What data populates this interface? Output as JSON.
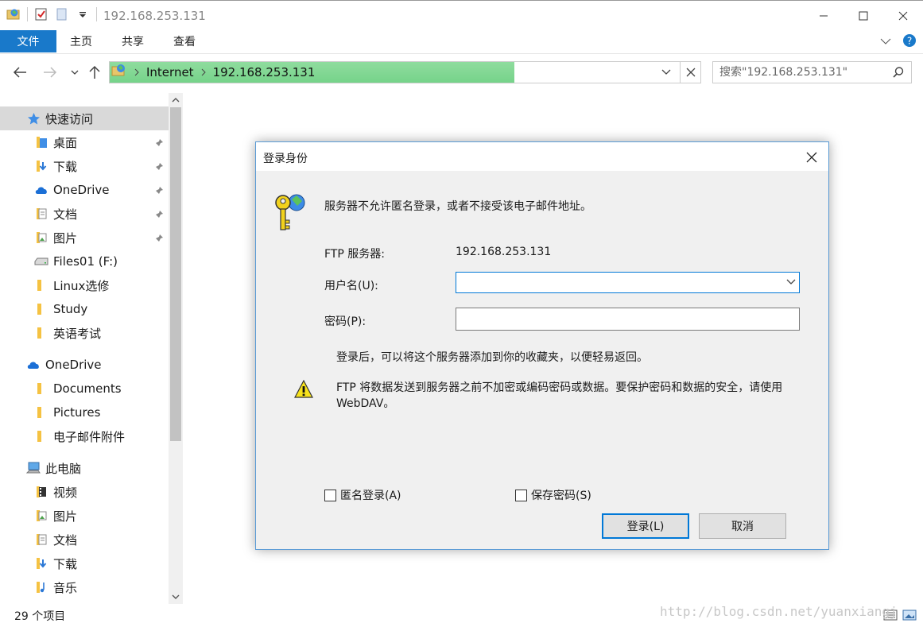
{
  "window": {
    "title": "192.168.253.131"
  },
  "ribbon": {
    "file": "文件",
    "tabs": [
      "主页",
      "共享",
      "查看"
    ]
  },
  "address": {
    "segments": [
      "Internet",
      "192.168.253.131"
    ]
  },
  "search": {
    "placeholder": "搜索\"192.168.253.131\""
  },
  "sidebar": {
    "items": [
      {
        "label": "快速访问",
        "icon": "star-icon"
      },
      {
        "label": "桌面",
        "icon": "folder-icon"
      },
      {
        "label": "下载",
        "icon": "download-folder-icon"
      },
      {
        "label": "OneDrive",
        "icon": "cloud-icon"
      },
      {
        "label": "文档",
        "icon": "document-folder-icon"
      },
      {
        "label": "图片",
        "icon": "picture-folder-icon"
      },
      {
        "label": "Files01 (F:)",
        "icon": "drive-icon"
      },
      {
        "label": "Linux选修",
        "icon": "folder-icon"
      },
      {
        "label": "Study",
        "icon": "folder-icon"
      },
      {
        "label": "英语考试",
        "icon": "folder-icon"
      },
      {
        "label": "OneDrive",
        "icon": "cloud-icon"
      },
      {
        "label": "Documents",
        "icon": "folder-icon"
      },
      {
        "label": "Pictures",
        "icon": "folder-icon"
      },
      {
        "label": "电子邮件附件",
        "icon": "folder-icon"
      },
      {
        "label": "此电脑",
        "icon": "computer-icon"
      },
      {
        "label": "视频",
        "icon": "video-folder-icon"
      },
      {
        "label": "图片",
        "icon": "picture-folder-icon"
      },
      {
        "label": "文档",
        "icon": "document-folder-icon"
      },
      {
        "label": "下载",
        "icon": "download-folder-icon"
      },
      {
        "label": "音乐",
        "icon": "music-folder-icon"
      }
    ]
  },
  "status": {
    "count": "29 个项目"
  },
  "watermark": "http://blog.csdn.net/yuanxiangj",
  "dialog": {
    "title": "登录身份",
    "message": "服务器不允许匿名登录，或者不接受该电子邮件地址。",
    "server_label": "FTP 服务器:",
    "server_value": "192.168.253.131",
    "username_label": "用户名(U):",
    "username_value": "",
    "password_label": "密码(P):",
    "password_value": "",
    "info": "登录后，可以将这个服务器添加到你的收藏夹，以便轻易返回。",
    "warning": "FTP 将数据发送到服务器之前不加密或编码密码或数据。要保护密码和数据的安全，请使用 WebDAV。",
    "anon_label": "匿名登录(A)",
    "save_label": "保存密码(S)",
    "login_button": "登录(L)",
    "cancel_button": "取消"
  },
  "colors": {
    "accent": "#1979ca",
    "progress": "#7ad58d",
    "dialog_border": "#5b9bd5"
  }
}
